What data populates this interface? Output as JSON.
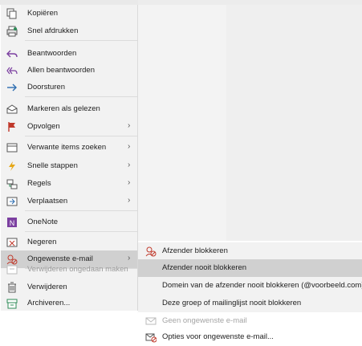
{
  "background": {
    "title_fragment": "…"
  },
  "menu": {
    "items": [
      {
        "label": "Kopiëren",
        "icon": "copy-icon"
      },
      {
        "label": "Snel afdrukken",
        "icon": "print-icon"
      },
      {
        "label": "Beantwoorden",
        "icon": "reply-icon"
      },
      {
        "label": "Allen beantwoorden",
        "icon": "reply-all-icon"
      },
      {
        "label": "Doorsturen",
        "icon": "forward-icon"
      },
      {
        "label": "Markeren als gelezen",
        "icon": "mark-read-icon"
      },
      {
        "label": "Opvolgen",
        "icon": "flag-icon",
        "submenu": true
      },
      {
        "label": "Verwante items zoeken",
        "icon": "related-items-icon",
        "submenu": true
      },
      {
        "label": "Snelle stappen",
        "icon": "lightning-icon",
        "submenu": true
      },
      {
        "label": "Regels",
        "icon": "rules-icon",
        "submenu": true
      },
      {
        "label": "Verplaatsen",
        "icon": "move-icon",
        "submenu": true
      },
      {
        "label": "OneNote",
        "icon": "onenote-icon"
      },
      {
        "label": "Negeren",
        "icon": "ignore-icon"
      },
      {
        "label": "Ongewenste e-mail",
        "icon": "junk-mail-icon",
        "submenu": true,
        "selected": true
      },
      {
        "label": "Verwijderen ongedaan maken",
        "icon": "undo-delete-icon",
        "disabled": true
      },
      {
        "label": "Verwijderen",
        "icon": "trash-icon"
      },
      {
        "label": "Archiveren...",
        "icon": "archive-icon"
      }
    ],
    "chevron": "›"
  },
  "submenu": {
    "items": [
      {
        "label": "Afzender blokkeren",
        "icon": "block-sender-icon"
      },
      {
        "label": "Afzender nooit blokkeren",
        "icon": "",
        "selected": true
      },
      {
        "label": "Domein van de afzender nooit blokkeren (@voorbeeld.com)",
        "icon": ""
      },
      {
        "label": "Deze groep of mailinglijst nooit blokkeren",
        "icon": ""
      }
    ],
    "extra": [
      {
        "label": "Geen ongewenste e-mail",
        "icon": "not-junk-icon",
        "disabled": true
      },
      {
        "label": "Opties voor ongewenste e-mail...",
        "icon": "junk-options-icon"
      }
    ]
  },
  "colors": {
    "accent_red": "#c0392b",
    "accent_blue": "#2b6cb0",
    "accent_green": "#2e8b57",
    "accent_purple": "#7b3fa0"
  }
}
